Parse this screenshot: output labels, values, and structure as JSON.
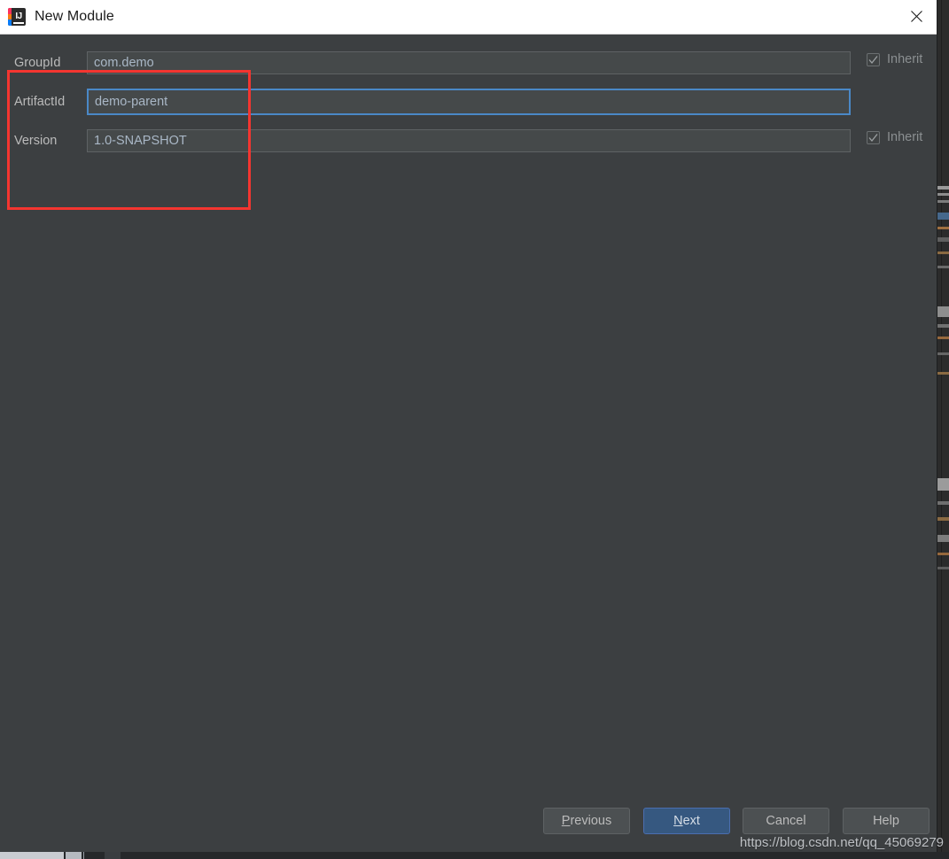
{
  "window": {
    "title": "New Module",
    "app_icon": "intellij-idea-icon",
    "close_icon": "close-icon"
  },
  "form": {
    "rows": [
      {
        "label": "GroupId",
        "value": "com.demo",
        "focused": false,
        "inherit": {
          "label": "Inherit",
          "checked": true,
          "visible": true
        }
      },
      {
        "label": "ArtifactId",
        "value": "demo-parent",
        "focused": true,
        "inherit": {
          "label": "",
          "checked": false,
          "visible": false
        }
      },
      {
        "label": "Version",
        "value": "1.0-SNAPSHOT",
        "focused": false,
        "inherit": {
          "label": "Inherit",
          "checked": true,
          "visible": true
        }
      }
    ]
  },
  "annotation": {
    "type": "highlight-rectangle",
    "color": "#f43530"
  },
  "footer": {
    "buttons": [
      {
        "name": "previous",
        "label_before": "",
        "mnemonic": "P",
        "label_after": "revious",
        "primary": false
      },
      {
        "name": "next",
        "label_before": "",
        "mnemonic": "N",
        "label_after": "ext",
        "primary": true
      },
      {
        "name": "cancel",
        "label_before": "Cancel",
        "mnemonic": "",
        "label_after": "",
        "primary": false
      },
      {
        "name": "help",
        "label_before": "Help",
        "mnemonic": "",
        "label_after": "",
        "primary": false
      }
    ]
  },
  "watermark": {
    "text": "https://blog.csdn.net/qq_45069279"
  },
  "colors": {
    "dialog_background": "#3c3f41",
    "field_background": "#45494a",
    "focus_border": "#4a88c7",
    "primary_button": "#365880",
    "annotation": "#f43530",
    "titlebar": "#ffffff"
  }
}
